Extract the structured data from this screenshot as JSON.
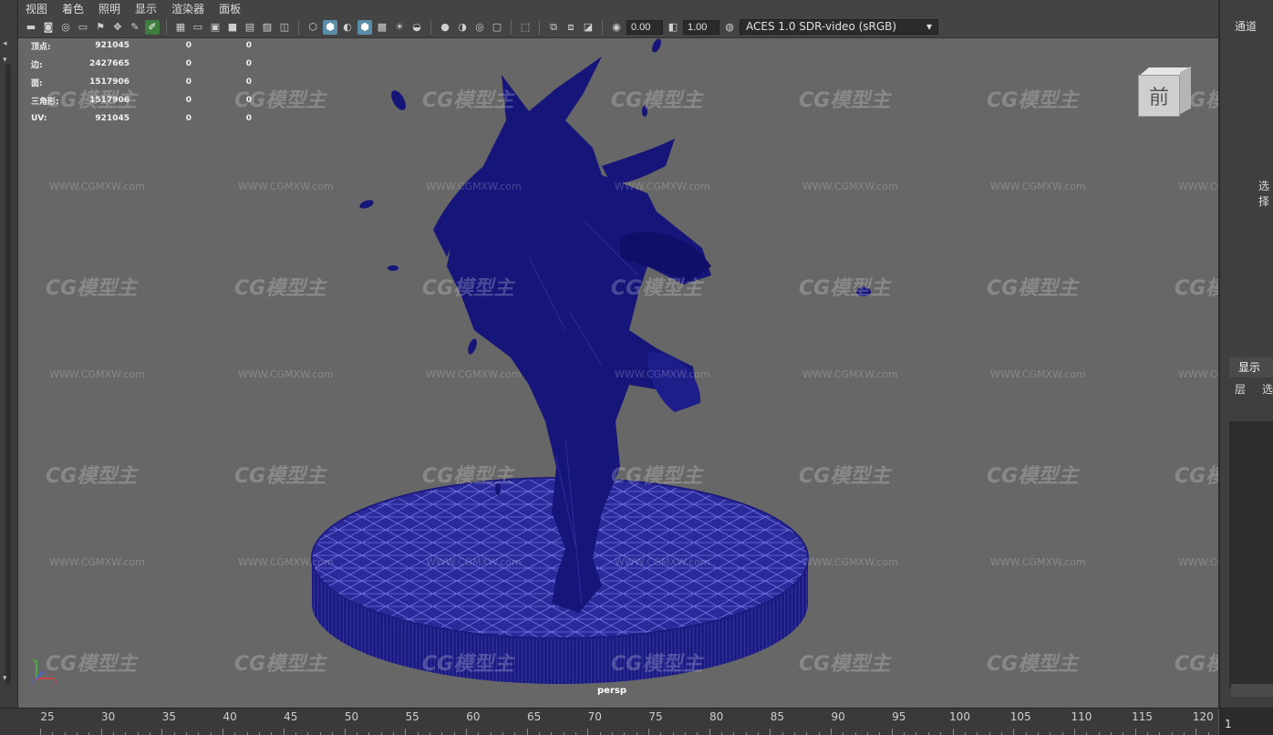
{
  "menubar": {
    "items": [
      "视图",
      "着色",
      "照明",
      "显示",
      "渲染器",
      "面板"
    ]
  },
  "toolbar": {
    "value_a": "0.00",
    "value_b": "1.00",
    "colorspace": "ACES 1.0 SDR-video (sRGB)"
  },
  "hud": {
    "rows": [
      {
        "label": "顶点:",
        "v1": "921045",
        "v2": "0",
        "v3": "0"
      },
      {
        "label": "边:",
        "v1": "2427665",
        "v2": "0",
        "v3": "0"
      },
      {
        "label": "面:",
        "v1": "1517906",
        "v2": "0",
        "v3": "0"
      },
      {
        "label": "三角形:",
        "v1": "1517906",
        "v2": "0",
        "v3": "0"
      },
      {
        "label": "UV:",
        "v1": "921045",
        "v2": "0",
        "v3": "0"
      }
    ]
  },
  "viewcube": {
    "face_label": "前"
  },
  "viewport": {
    "camera": "persp"
  },
  "watermark": {
    "logo": "CG模型主",
    "url": "WWW.CGMXW.com"
  },
  "right_panel": {
    "channels_tab": "通道",
    "select_label": "选择",
    "display_tab": "显示",
    "layer_tab": "层",
    "options_tab": "选"
  },
  "timeline": {
    "ticks": [
      "25",
      "30",
      "35",
      "40",
      "45",
      "50",
      "55",
      "60",
      "65",
      "70",
      "75",
      "80",
      "85",
      "90",
      "95",
      "100",
      "105",
      "110",
      "115",
      "120"
    ],
    "current_frame": "1"
  },
  "colors": {
    "mesh": "#1a1a80",
    "viewport_bg": "#676767",
    "panel": "#444444"
  }
}
